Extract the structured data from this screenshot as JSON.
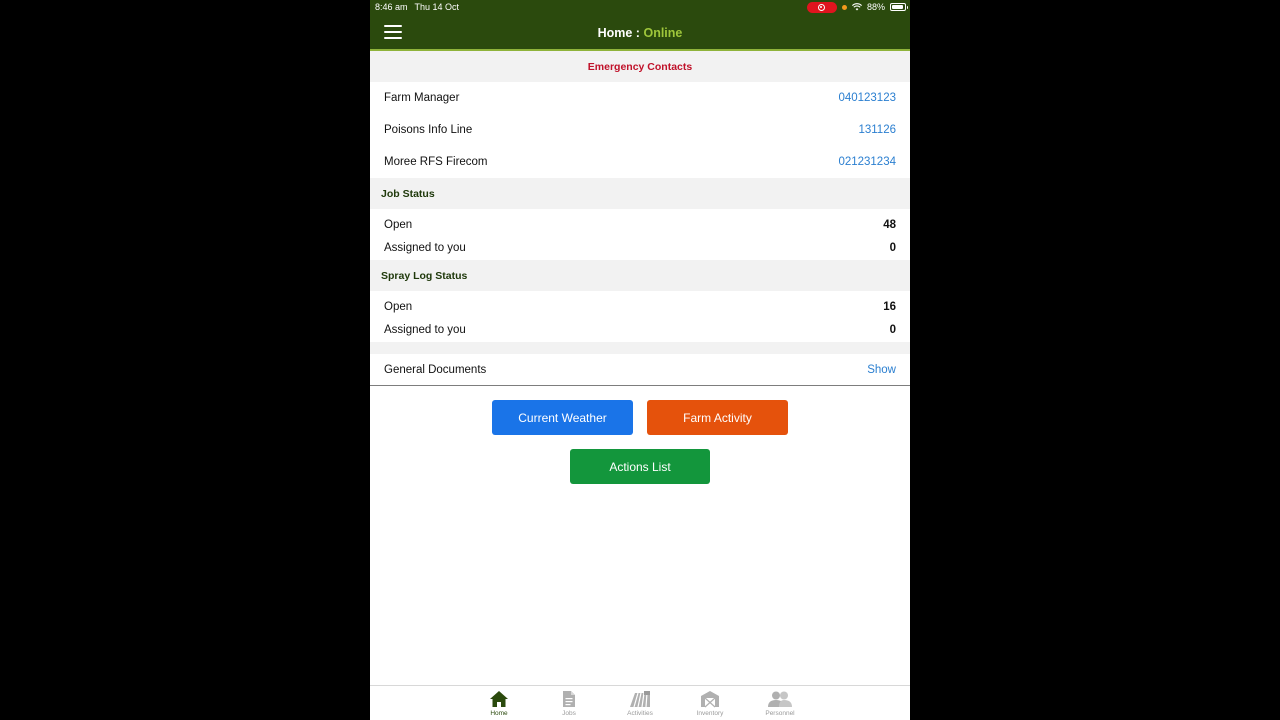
{
  "status_bar": {
    "time": "8:46 am",
    "date": "Thu 14 Oct",
    "battery": "88%"
  },
  "header": {
    "title_prefix": "Home :",
    "connection_status": "Online"
  },
  "emergency_contacts": {
    "title": "Emergency Contacts",
    "contacts": [
      {
        "name": "Farm Manager",
        "phone": "040123123"
      },
      {
        "name": "Poisons Info Line",
        "phone": "131126"
      },
      {
        "name": "Moree RFS Firecom",
        "phone": "021231234"
      }
    ]
  },
  "job_status": {
    "title": "Job Status",
    "rows": [
      {
        "label": "Open",
        "value": "48"
      },
      {
        "label": "Assigned to you",
        "value": "0"
      }
    ]
  },
  "spray_log_status": {
    "title": "Spray Log Status",
    "rows": [
      {
        "label": "Open",
        "value": "16"
      },
      {
        "label": "Assigned to you",
        "value": "0"
      }
    ]
  },
  "general_documents": {
    "label": "General Documents",
    "action": "Show"
  },
  "buttons": {
    "current_weather": "Current Weather",
    "farm_activity": "Farm Activity",
    "actions_list": "Actions List"
  },
  "tabs": [
    {
      "label": "Home",
      "icon": "home-icon",
      "active": true
    },
    {
      "label": "Jobs",
      "icon": "document-icon",
      "active": false
    },
    {
      "label": "Activities",
      "icon": "field-icon",
      "active": false
    },
    {
      "label": "Inventory",
      "icon": "shed-icon",
      "active": false
    },
    {
      "label": "Personnel",
      "icon": "people-icon",
      "active": false
    }
  ],
  "colors": {
    "header_bg": "#2b4a0d",
    "online": "#9fc63b",
    "emergency_title": "#c0122a",
    "link": "#2b7fd0",
    "weather_button": "#1a74e8",
    "farm_button": "#e5520c",
    "actions_button": "#13963c"
  }
}
